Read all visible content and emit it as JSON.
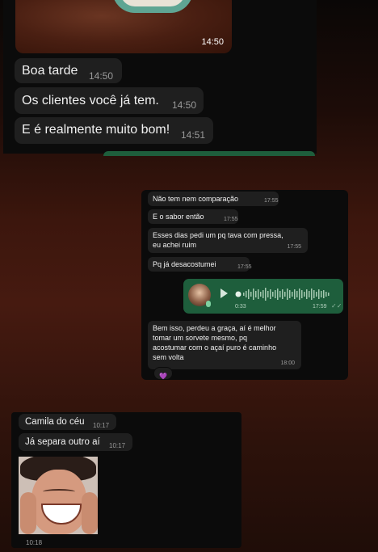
{
  "panel_top": {
    "image_time": "14:50",
    "messages": [
      {
        "text": "Boa tarde",
        "time": "14:50"
      },
      {
        "text": "Os clientes você já tem.",
        "time": "14:50"
      },
      {
        "text": "E é realmente muito bom!",
        "time": "14:51"
      }
    ]
  },
  "panel_middle": {
    "messages": [
      {
        "text": "Não tem nem comparação",
        "time": "17:55"
      },
      {
        "text": "E o sabor então",
        "time": "17:55"
      },
      {
        "text_line1": "Esses dias pedi um pq tava com pressa,",
        "text_line2": "eu achei ruim",
        "time": "17:55"
      },
      {
        "text": "Pq já desacostumei",
        "time": "17:55"
      }
    ],
    "voice": {
      "duration": "0:33",
      "time": "17:59",
      "read_icon": "double-check-icon"
    },
    "last_message": {
      "line1": "Bem isso, perdeu a graça, aí é melhor",
      "line2": "tomar um sorvete mesmo, pq",
      "line3": "acostumar com o açaí puro é caminho",
      "line4": "sem volta",
      "time": "18:00",
      "reaction": "💜"
    }
  },
  "panel_bottom": {
    "messages": [
      {
        "text": "Camila do céu",
        "time": "10:17"
      },
      {
        "text": "Já separa outro aí",
        "time": "10:17"
      }
    ],
    "image_time": "10:18"
  },
  "colors": {
    "outgoing": "#1e5e3c",
    "incoming": "#1f1f1f",
    "panel": "#0b0b0b"
  }
}
